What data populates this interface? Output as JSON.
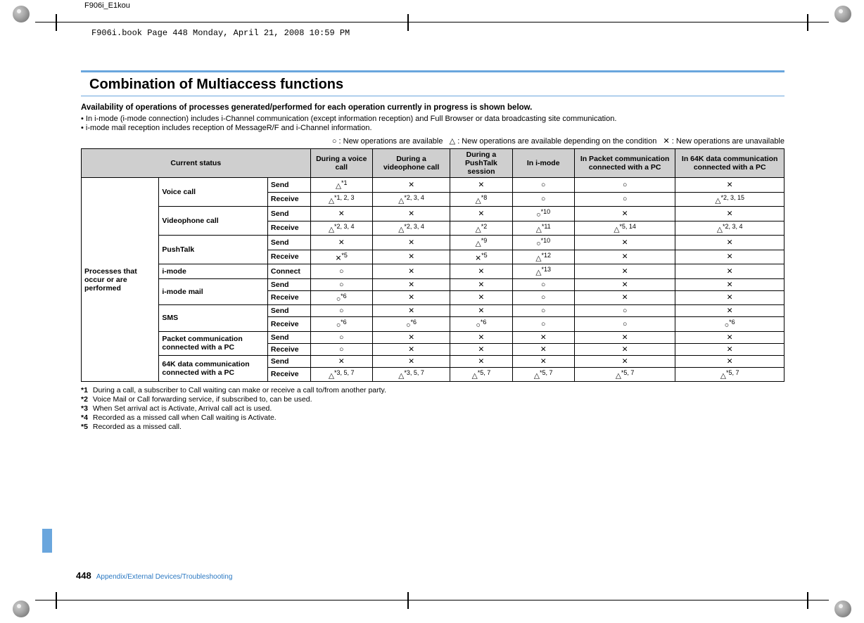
{
  "docid": "F906i_E1kou",
  "bookline": "F906i.book  Page 448  Monday, April 21, 2008  10:59 PM",
  "title": "Combination of Multiaccess functions",
  "intro": "Availability of operations of processes generated/performed for each operation currently in progress is shown below.",
  "bullets": [
    "In i-mode (i-mode connection) includes i-Channel communication (except information reception) and Full Browser or data broadcasting site communication.",
    "i-mode mail reception includes reception of MessageR/F and i-Channel information."
  ],
  "legend": {
    "avail": "○ : New operations are available",
    "cond": "△ : New operations are available depending on the condition",
    "unavail": "✕ : New operations are unavailable"
  },
  "table": {
    "corner": "Current status",
    "side": "Processes that occur or are performed",
    "columns": [
      "During a voice call",
      "During a videophone call",
      "During a PushTalk session",
      "In i-mode",
      "In Packet communication connected with a PC",
      "In 64K data communication connected with a PC"
    ],
    "groups": [
      {
        "label": "Voice call",
        "rows": [
          {
            "act": "Send",
            "cells": [
              {
                "s": "△",
                "n": "*1"
              },
              {
                "s": "✕"
              },
              {
                "s": "✕"
              },
              {
                "s": "○"
              },
              {
                "s": "○"
              },
              {
                "s": "✕"
              }
            ]
          },
          {
            "act": "Receive",
            "cells": [
              {
                "s": "△",
                "n": "*1, 2, 3"
              },
              {
                "s": "△",
                "n": "*2, 3, 4"
              },
              {
                "s": "△",
                "n": "*8"
              },
              {
                "s": "○"
              },
              {
                "s": "○"
              },
              {
                "s": "△",
                "n": "*2, 3, 15"
              }
            ]
          }
        ]
      },
      {
        "label": "Videophone call",
        "rows": [
          {
            "act": "Send",
            "cells": [
              {
                "s": "✕"
              },
              {
                "s": "✕"
              },
              {
                "s": "✕"
              },
              {
                "s": "○",
                "n": "*10"
              },
              {
                "s": "✕"
              },
              {
                "s": "✕"
              }
            ]
          },
          {
            "act": "Receive",
            "cells": [
              {
                "s": "△",
                "n": "*2, 3, 4"
              },
              {
                "s": "△",
                "n": "*2, 3, 4"
              },
              {
                "s": "△",
                "n": "*2"
              },
              {
                "s": "△",
                "n": "*11"
              },
              {
                "s": "△",
                "n": "*5, 14"
              },
              {
                "s": "△",
                "n": "*2, 3, 4"
              }
            ]
          }
        ]
      },
      {
        "label": "PushTalk",
        "rows": [
          {
            "act": "Send",
            "cells": [
              {
                "s": "✕"
              },
              {
                "s": "✕"
              },
              {
                "s": "△",
                "n": "*9"
              },
              {
                "s": "○",
                "n": "*10"
              },
              {
                "s": "✕"
              },
              {
                "s": "✕"
              }
            ]
          },
          {
            "act": "Receive",
            "cells": [
              {
                "s": "✕",
                "n": "*5"
              },
              {
                "s": "✕"
              },
              {
                "s": "✕",
                "n": "*5"
              },
              {
                "s": "△",
                "n": "*12"
              },
              {
                "s": "✕"
              },
              {
                "s": "✕"
              }
            ]
          }
        ]
      },
      {
        "label": "i-mode",
        "rows": [
          {
            "act": "Connect",
            "cells": [
              {
                "s": "○"
              },
              {
                "s": "✕"
              },
              {
                "s": "✕"
              },
              {
                "s": "△",
                "n": "*13"
              },
              {
                "s": "✕"
              },
              {
                "s": "✕"
              }
            ]
          }
        ]
      },
      {
        "label": "i-mode mail",
        "rows": [
          {
            "act": "Send",
            "cells": [
              {
                "s": "○"
              },
              {
                "s": "✕"
              },
              {
                "s": "✕"
              },
              {
                "s": "○"
              },
              {
                "s": "✕"
              },
              {
                "s": "✕"
              }
            ]
          },
          {
            "act": "Receive",
            "cells": [
              {
                "s": "○",
                "n": "*6"
              },
              {
                "s": "✕"
              },
              {
                "s": "✕"
              },
              {
                "s": "○"
              },
              {
                "s": "✕"
              },
              {
                "s": "✕"
              }
            ]
          }
        ]
      },
      {
        "label": "SMS",
        "rows": [
          {
            "act": "Send",
            "cells": [
              {
                "s": "○"
              },
              {
                "s": "✕"
              },
              {
                "s": "✕"
              },
              {
                "s": "○"
              },
              {
                "s": "○"
              },
              {
                "s": "✕"
              }
            ]
          },
          {
            "act": "Receive",
            "cells": [
              {
                "s": "○",
                "n": "*6"
              },
              {
                "s": "○",
                "n": "*6"
              },
              {
                "s": "○",
                "n": "*6"
              },
              {
                "s": "○"
              },
              {
                "s": "○"
              },
              {
                "s": "○",
                "n": "*6"
              }
            ]
          }
        ]
      },
      {
        "label": "Packet communication connected with a PC",
        "rows": [
          {
            "act": "Send",
            "cells": [
              {
                "s": "○"
              },
              {
                "s": "✕"
              },
              {
                "s": "✕"
              },
              {
                "s": "✕"
              },
              {
                "s": "✕"
              },
              {
                "s": "✕"
              }
            ]
          },
          {
            "act": "Receive",
            "cells": [
              {
                "s": "○"
              },
              {
                "s": "✕"
              },
              {
                "s": "✕"
              },
              {
                "s": "✕"
              },
              {
                "s": "✕"
              },
              {
                "s": "✕"
              }
            ]
          }
        ]
      },
      {
        "label": "64K data communication connected with a PC",
        "rows": [
          {
            "act": "Send",
            "cells": [
              {
                "s": "✕"
              },
              {
                "s": "✕"
              },
              {
                "s": "✕"
              },
              {
                "s": "✕"
              },
              {
                "s": "✕"
              },
              {
                "s": "✕"
              }
            ]
          },
          {
            "act": "Receive",
            "cells": [
              {
                "s": "△",
                "n": "*3, 5, 7"
              },
              {
                "s": "△",
                "n": "*3, 5, 7"
              },
              {
                "s": "△",
                "n": "*5, 7"
              },
              {
                "s": "△",
                "n": "*5, 7"
              },
              {
                "s": "△",
                "n": "*5, 7"
              },
              {
                "s": "△",
                "n": "*5, 7"
              }
            ]
          }
        ]
      }
    ]
  },
  "footnotes": [
    {
      "n": "*1",
      "t": "During a call, a subscriber to Call waiting can make or receive a call to/from another party."
    },
    {
      "n": "*2",
      "t": "Voice Mail or Call forwarding service, if subscribed to, can be used."
    },
    {
      "n": "*3",
      "t": "When Set arrival act is Activate, Arrival call act is used."
    },
    {
      "n": "*4",
      "t": "Recorded as a missed call when Call waiting is Activate."
    },
    {
      "n": "*5",
      "t": "Recorded as a missed call."
    }
  ],
  "pagefoot": {
    "num": "448",
    "section": "Appendix/External Devices/Troubleshooting"
  }
}
